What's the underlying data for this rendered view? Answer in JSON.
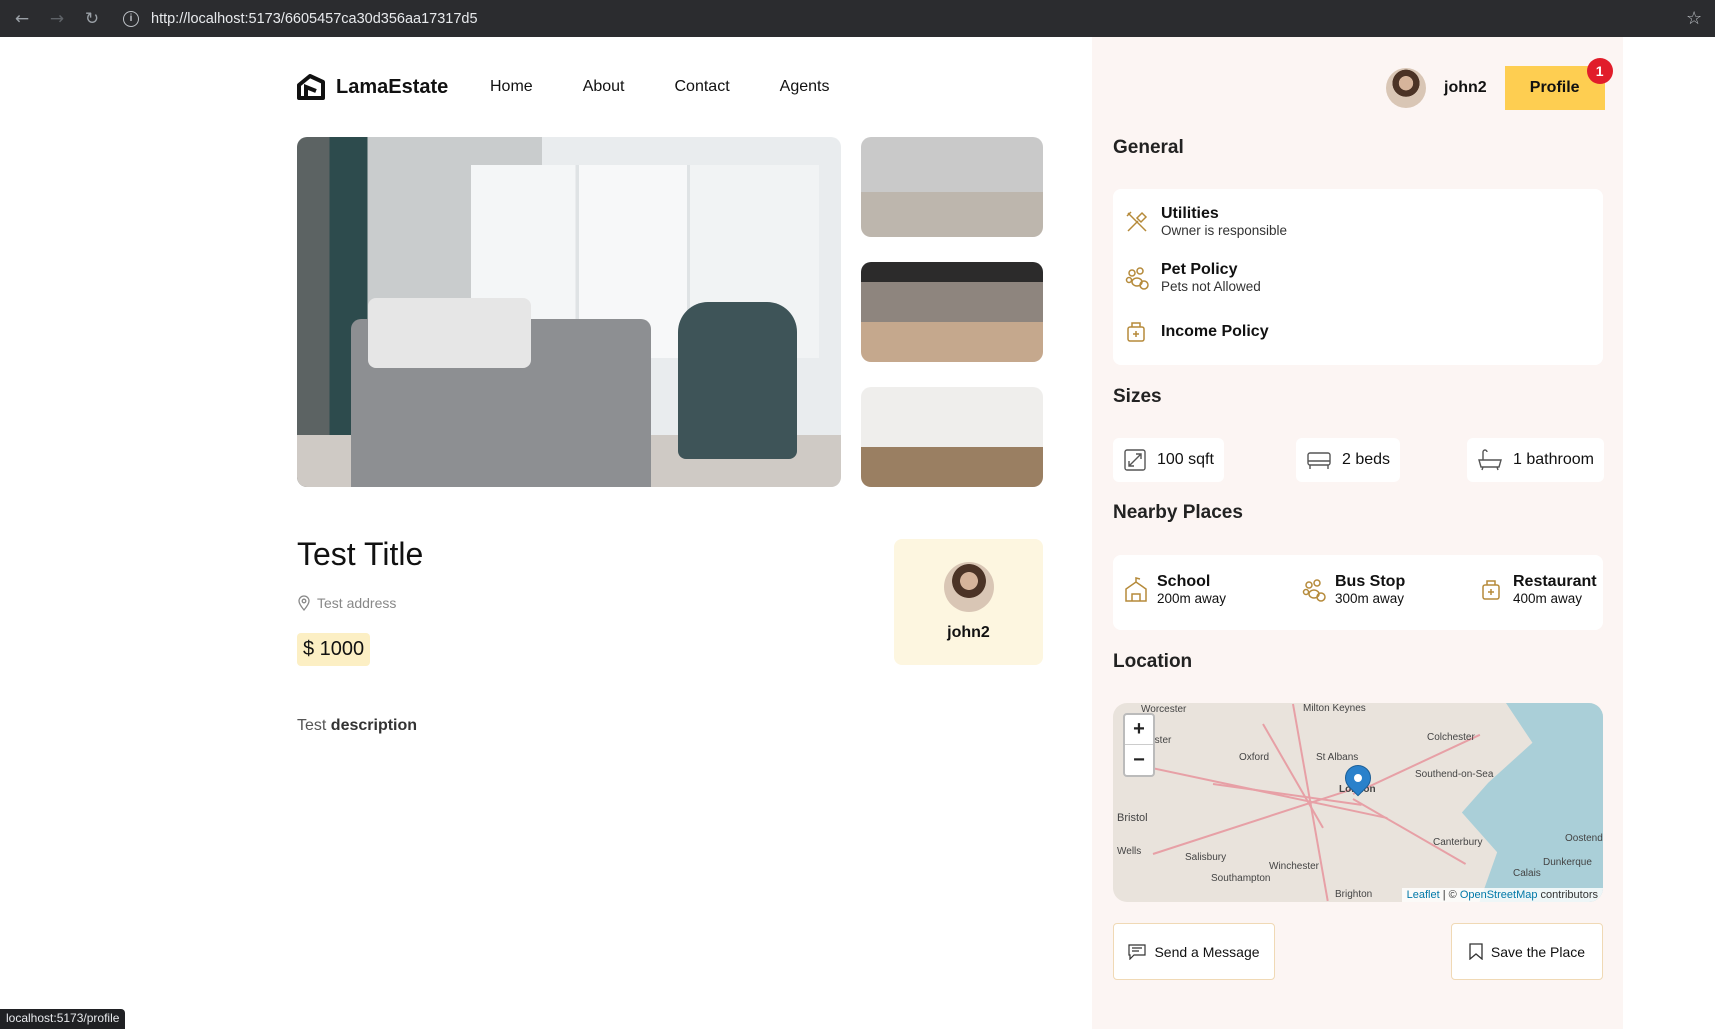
{
  "browser": {
    "url": "http://localhost:5173/6605457ca30d356aa17317d5",
    "status_url": "localhost:5173/profile"
  },
  "header": {
    "brand": "LamaEstate",
    "nav": [
      "Home",
      "About",
      "Contact",
      "Agents"
    ],
    "username": "john2",
    "profile_label": "Profile",
    "notification_count": "1"
  },
  "listing": {
    "title": "Test Title",
    "address": "Test address",
    "price": "$ 1000",
    "description_plain": "Test",
    "description_bold": "description",
    "owner": "john2"
  },
  "sidebar": {
    "general_title": "General",
    "general": [
      {
        "title": "Utilities",
        "sub": "Owner is responsible",
        "icon": "utilities-icon"
      },
      {
        "title": "Pet Policy",
        "sub": "Pets not Allowed",
        "icon": "pet-icon"
      },
      {
        "title": "Income Policy",
        "sub": "",
        "icon": "income-icon"
      }
    ],
    "sizes_title": "Sizes",
    "sizes": [
      "100 sqft",
      "2 beds",
      "1 bathroom"
    ],
    "nearby_title": "Nearby Places",
    "nearby": [
      {
        "title": "School",
        "sub": "200m away",
        "icon": "school-icon"
      },
      {
        "title": "Bus Stop",
        "sub": "300m away",
        "icon": "bus-icon"
      },
      {
        "title": "Restaurant",
        "sub": "400m away",
        "icon": "restaurant-icon"
      }
    ],
    "location_title": "Location",
    "map": {
      "cities": [
        "Milton Keynes",
        "Worcester",
        "Colchester",
        "Gloucester",
        "Oxford",
        "St Albans",
        "Southend-on-Sea",
        "London",
        "Bristol",
        "Canterbury",
        "Wells",
        "Salisbury",
        "Winchester",
        "Dunkerque",
        "Southampton",
        "Calais",
        "Brighton",
        "Oostende"
      ],
      "zoom_in": "+",
      "zoom_out": "−",
      "attribution_prefix": "Leaflet",
      "attribution_sep": " | © ",
      "attribution_link": "OpenStreetMap",
      "attribution_suffix": " contributors"
    },
    "send_message": "Send a Message",
    "save_place": "Save the Place"
  }
}
